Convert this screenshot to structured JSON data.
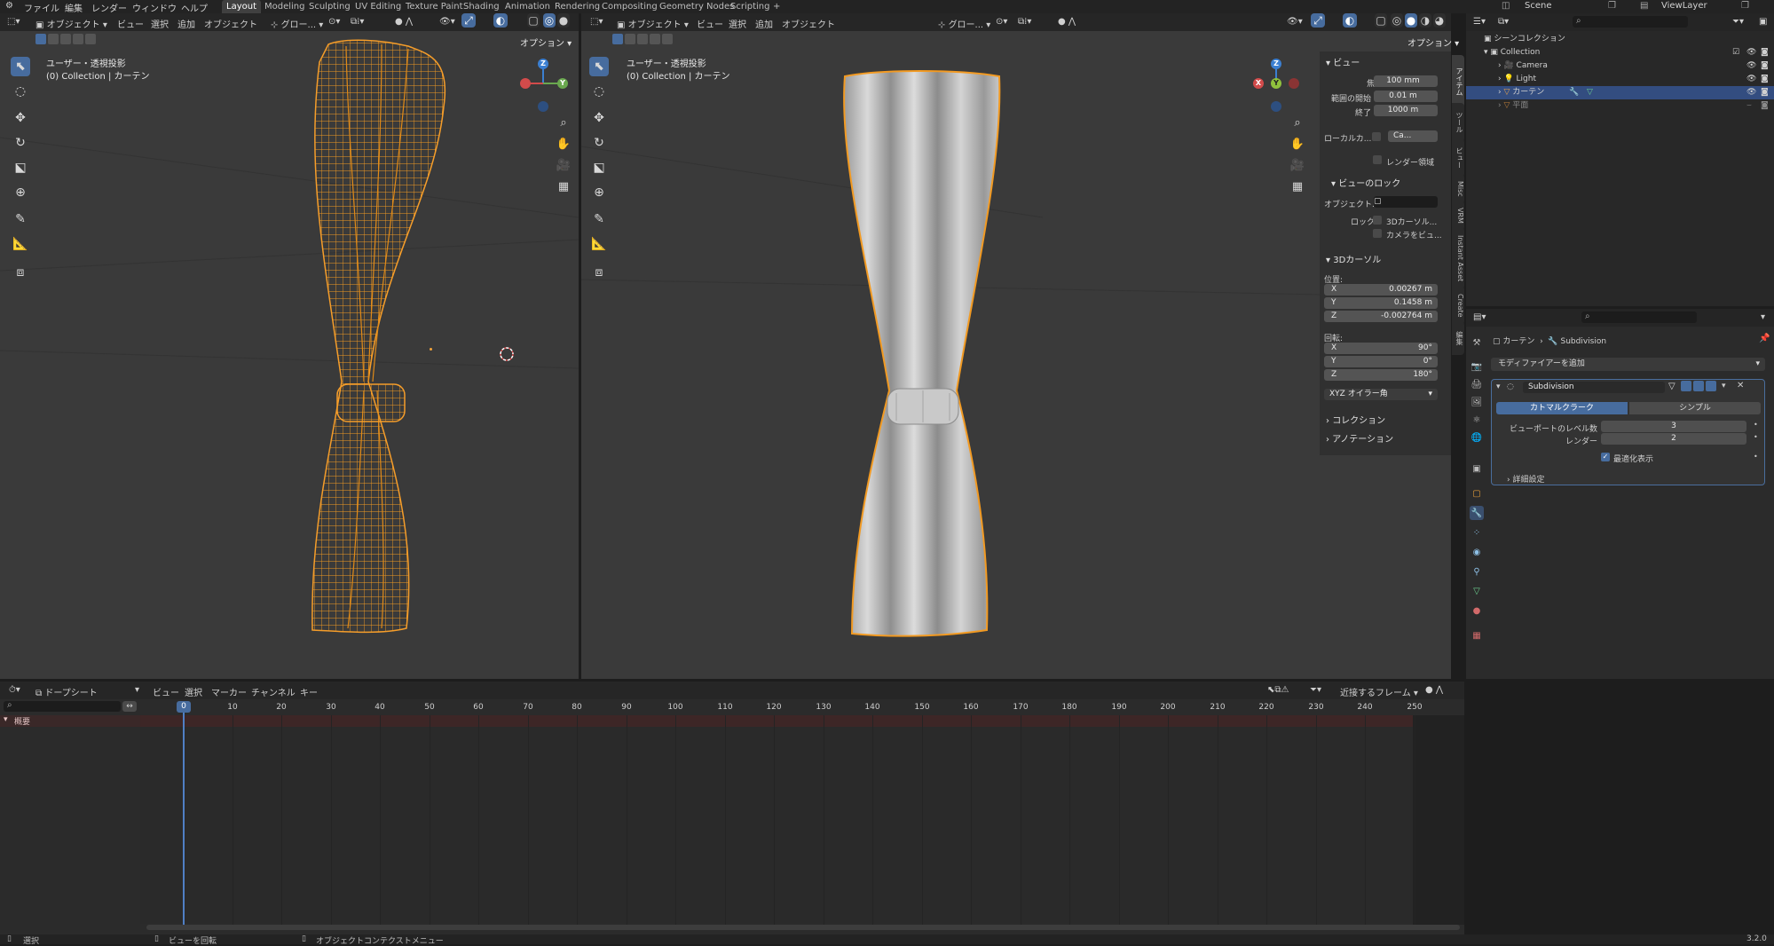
{
  "menubar": {
    "items": [
      "ファイル",
      "編集",
      "レンダー",
      "ウィンドウ",
      "ヘルプ"
    ],
    "workspaces": [
      "Layout",
      "Modeling",
      "Sculpting",
      "UV Editing",
      "Texture Paint",
      "Shading",
      "Animation",
      "Rendering",
      "Compositing",
      "Geometry Nodes",
      "Scripting"
    ],
    "active_workspace": "Layout",
    "add_tab": "+",
    "scene": "Scene",
    "view_layer": "ViewLayer"
  },
  "viewport_left": {
    "mode": "オブジェクト",
    "menus": [
      "ビュー",
      "選択",
      "追加",
      "オブジェクト"
    ],
    "transform_orientation": "グロー...",
    "options": "オプション",
    "view_name": "ユーザー・透視投影",
    "collection_info": "(0) Collection | カーテン"
  },
  "viewport_right": {
    "mode": "オブジェクト",
    "menus": [
      "ビュー",
      "選択",
      "追加",
      "オブジェクト"
    ],
    "transform_orientation": "グロー...",
    "options": "オプション",
    "view_name": "ユーザー・透視投影",
    "collection_info": "(0) Collection | カーテン"
  },
  "gizmo": {
    "z": "Z",
    "y": "Y",
    "x": "X"
  },
  "npanel": {
    "view_header": "ビュー",
    "focal_label": "焦点距離",
    "focal_value": "100 mm",
    "clip_start_label": "範囲の開始",
    "clip_start_value": "0.01 m",
    "clip_end_label": "終了",
    "clip_end_value": "1000 m",
    "local_camera_label": "ローカルカ...",
    "local_camera_value": "Ca...",
    "render_region_label": "レンダー領域",
    "view_lock_header": "ビューのロック",
    "object_label": "オブジェクト...",
    "lock_label": "ロック",
    "lock_cursor": "3Dカーソル...",
    "lock_camera": "カメラをビュ...",
    "cursor_header": "3Dカーソル",
    "location_label": "位置:",
    "loc_x": "0.00267 m",
    "loc_y": "0.1458 m",
    "loc_z": "-0.002764 m",
    "rotation_label": "回転:",
    "rot_x": "90°",
    "rot_y": "0°",
    "rot_z": "180°",
    "axis_x": "X",
    "axis_y": "Y",
    "axis_z": "Z",
    "rotation_mode": "XYZ オイラー角",
    "collection_header": "コレクション",
    "annotation_header": "アノテーション",
    "tabs": [
      "アイテム",
      "ツール",
      "ビュー",
      "Misc",
      "VRM",
      "Instant Asset",
      "Create",
      "編集"
    ]
  },
  "outliner": {
    "scene_collection": "シーンコレクション",
    "items": [
      {
        "name": "Collection",
        "indent": 1,
        "selected": false
      },
      {
        "name": "Camera",
        "indent": 2,
        "selected": false
      },
      {
        "name": "Light",
        "indent": 2,
        "selected": false
      },
      {
        "name": "カーテン",
        "indent": 2,
        "selected": true
      },
      {
        "name": "平面",
        "indent": 2,
        "selected": false
      }
    ]
  },
  "properties": {
    "breadcrumb_object": "カーテン",
    "breadcrumb_modifier": "Subdivision",
    "add_modifier": "モディファイアーを追加",
    "modifier_name": "Subdivision",
    "type_catmull": "カトマルクラーク",
    "type_simple": "シンプル",
    "viewport_levels_label": "ビューポートのレベル数",
    "viewport_levels_value": "3",
    "render_label": "レンダー",
    "render_value": "2",
    "optimal_display": "最適化表示",
    "advanced": "詳細設定"
  },
  "timeline": {
    "editor": "ドープシート",
    "menus": [
      "ビュー",
      "選択",
      "マーカー",
      "チャンネル",
      "キー"
    ],
    "snap": "近接するフレーム",
    "current_frame": "0",
    "summary": "概要",
    "ticks": [
      "10",
      "20",
      "30",
      "40",
      "50",
      "60",
      "70",
      "80",
      "90",
      "100",
      "110",
      "120",
      "130",
      "140",
      "150",
      "160",
      "170",
      "180",
      "190",
      "200",
      "210",
      "220",
      "230",
      "240",
      "250"
    ]
  },
  "statusbar": {
    "select": "選択",
    "rotate_view": "ビューを回転",
    "context_menu": "オブジェクトコンテクストメニュー",
    "version": "3.2.0"
  }
}
